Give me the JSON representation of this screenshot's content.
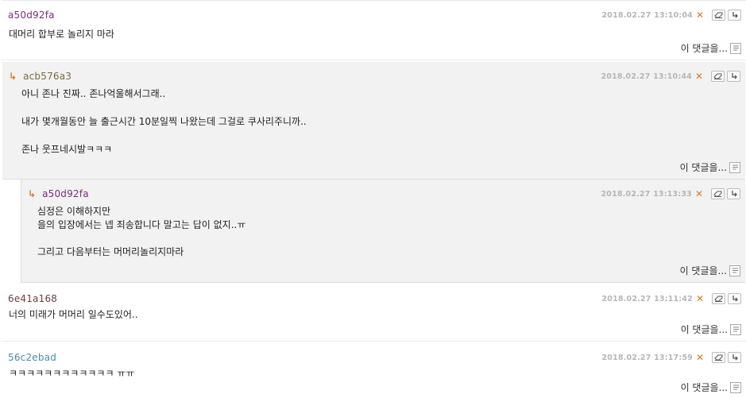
{
  "comments": [
    {
      "author": "a50d92fa",
      "author_color": "#7b2d83",
      "date": "2018.02.27",
      "time": "13:10:04",
      "body": "대머리 합부로 놀리지 마라",
      "reply_label": "이 댓글을..."
    },
    {
      "author": "acb576a3",
      "author_color": "#7a6a3e",
      "date": "2018.02.27",
      "time": "13:10:44",
      "body": "아니 존나 진짜.. 존나억울해서그래..\n\n내가 몇개월동안 늘 출근시간 10분일찍 나왔는데 그걸로 쿠사리주니까..\n\n존나 웃프네시발ㅋㅋㅋ",
      "reply_label": "이 댓글을..."
    },
    {
      "author": "a50d92fa",
      "author_color": "#7b2d83",
      "date": "2018.02.27",
      "time": "13:13:33",
      "body": "심정은 이해하지만\n을의 입장에서는 넵 죄송합니다 말고는 답이 없지..ㅠ\n\n그리고 다음부터는 머머리놀리지마라",
      "reply_label": "이 댓글을..."
    },
    {
      "author": "6e41a168",
      "author_color": "#6b3f3f",
      "date": "2018.02.27",
      "time": "13:11:42",
      "body": "너의 미래가 머머리 일수도있어..",
      "reply_label": "이 댓글을..."
    },
    {
      "author": "56c2ebad",
      "author_color": "#4a8ca8",
      "date": "2018.02.27",
      "time": "13:17:59",
      "body": "ㅋㅋㅋㅋㅋㅋㅋㅋㅋㅋㅋㅋ ㅠㅠ",
      "reply_label": "이 댓글을..."
    }
  ],
  "icons": {
    "delete": "close-icon",
    "edit": "eraser-icon",
    "reply": "reply-arrow-icon",
    "reply_doc": "document-icon",
    "nested": "nested-reply-arrow-icon"
  },
  "colors": {
    "accent": "#e07a1f",
    "date": "#b6b6b6",
    "reply_background": "#f2f2f2"
  }
}
